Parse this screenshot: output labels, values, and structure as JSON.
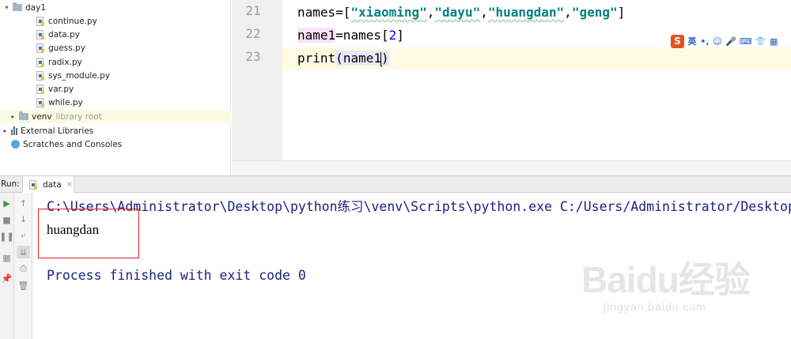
{
  "project_tree": {
    "items": [
      {
        "label": "day1",
        "kind": "folder",
        "expanded": true
      },
      {
        "label": "continue.py",
        "kind": "python-file"
      },
      {
        "label": "data.py",
        "kind": "python-file"
      },
      {
        "label": "guess.py",
        "kind": "python-file"
      },
      {
        "label": "radix.py",
        "kind": "python-file"
      },
      {
        "label": "sys_module.py",
        "kind": "python-file"
      },
      {
        "label": "var.py",
        "kind": "python-file"
      },
      {
        "label": "while.py",
        "kind": "python-file"
      },
      {
        "label": "venv",
        "suffix": "library root",
        "kind": "folder",
        "expanded": false
      },
      {
        "label": "External Libraries",
        "kind": "libraries"
      },
      {
        "label": "Scratches and Consoles",
        "kind": "scratches"
      }
    ]
  },
  "editor": {
    "line_numbers": [
      "21",
      "22",
      "23"
    ],
    "line21": {
      "prefix": "names=[",
      "s1": "\"xiaoming\"",
      "c1": ",",
      "s2": "\"dayu\"",
      "c2": ",",
      "s3": "\"huangdan\"",
      "c3": ",",
      "s4": "\"geng\"",
      "suffix": "]"
    },
    "line22": {
      "var": "name1",
      "eq": "=names",
      "open": "[",
      "index": "2",
      "close": "]"
    },
    "line23": {
      "func": "print",
      "open": "(",
      "arg": "name1",
      "close": ")"
    }
  },
  "ime_toolbar": {
    "logo": "S",
    "items": [
      "英",
      "•,",
      "☺",
      "🎤",
      "⌨",
      "👕",
      "▦"
    ]
  },
  "run_panel": {
    "label": "Run:",
    "tab": "data",
    "tab_close": "×",
    "command": "C:\\Users\\Administrator\\Desktop\\python练习\\venv\\Scripts\\python.exe C:/Users/Administrator/Desktop/",
    "output": "huangdan",
    "finish_message": "Process finished with exit code 0"
  },
  "watermark": {
    "brand": "Baidu经验",
    "url": "jingyan.baidu.com"
  },
  "colors": {
    "string": "#008080",
    "number": "#0000ff",
    "console_text": "#1a237e",
    "highlight_box": "#e02020",
    "current_line": "#fffae3"
  }
}
